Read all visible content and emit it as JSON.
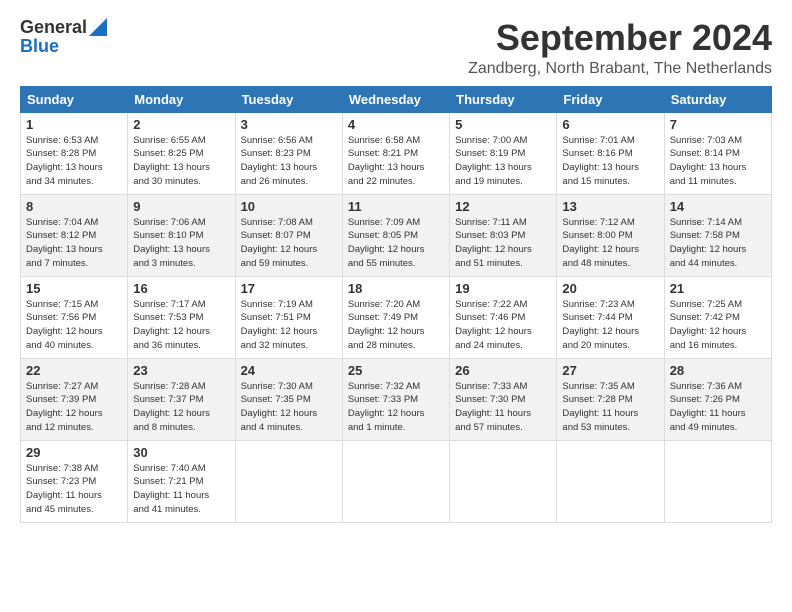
{
  "logo": {
    "general": "General",
    "blue": "Blue"
  },
  "header": {
    "month": "September 2024",
    "location": "Zandberg, North Brabant, The Netherlands"
  },
  "days_of_week": [
    "Sunday",
    "Monday",
    "Tuesday",
    "Wednesday",
    "Thursday",
    "Friday",
    "Saturday"
  ],
  "weeks": [
    [
      {
        "day": "1",
        "info": "Sunrise: 6:53 AM\nSunset: 8:28 PM\nDaylight: 13 hours\nand 34 minutes."
      },
      {
        "day": "2",
        "info": "Sunrise: 6:55 AM\nSunset: 8:25 PM\nDaylight: 13 hours\nand 30 minutes."
      },
      {
        "day": "3",
        "info": "Sunrise: 6:56 AM\nSunset: 8:23 PM\nDaylight: 13 hours\nand 26 minutes."
      },
      {
        "day": "4",
        "info": "Sunrise: 6:58 AM\nSunset: 8:21 PM\nDaylight: 13 hours\nand 22 minutes."
      },
      {
        "day": "5",
        "info": "Sunrise: 7:00 AM\nSunset: 8:19 PM\nDaylight: 13 hours\nand 19 minutes."
      },
      {
        "day": "6",
        "info": "Sunrise: 7:01 AM\nSunset: 8:16 PM\nDaylight: 13 hours\nand 15 minutes."
      },
      {
        "day": "7",
        "info": "Sunrise: 7:03 AM\nSunset: 8:14 PM\nDaylight: 13 hours\nand 11 minutes."
      }
    ],
    [
      {
        "day": "8",
        "info": "Sunrise: 7:04 AM\nSunset: 8:12 PM\nDaylight: 13 hours\nand 7 minutes."
      },
      {
        "day": "9",
        "info": "Sunrise: 7:06 AM\nSunset: 8:10 PM\nDaylight: 13 hours\nand 3 minutes."
      },
      {
        "day": "10",
        "info": "Sunrise: 7:08 AM\nSunset: 8:07 PM\nDaylight: 12 hours\nand 59 minutes."
      },
      {
        "day": "11",
        "info": "Sunrise: 7:09 AM\nSunset: 8:05 PM\nDaylight: 12 hours\nand 55 minutes."
      },
      {
        "day": "12",
        "info": "Sunrise: 7:11 AM\nSunset: 8:03 PM\nDaylight: 12 hours\nand 51 minutes."
      },
      {
        "day": "13",
        "info": "Sunrise: 7:12 AM\nSunset: 8:00 PM\nDaylight: 12 hours\nand 48 minutes."
      },
      {
        "day": "14",
        "info": "Sunrise: 7:14 AM\nSunset: 7:58 PM\nDaylight: 12 hours\nand 44 minutes."
      }
    ],
    [
      {
        "day": "15",
        "info": "Sunrise: 7:15 AM\nSunset: 7:56 PM\nDaylight: 12 hours\nand 40 minutes."
      },
      {
        "day": "16",
        "info": "Sunrise: 7:17 AM\nSunset: 7:53 PM\nDaylight: 12 hours\nand 36 minutes."
      },
      {
        "day": "17",
        "info": "Sunrise: 7:19 AM\nSunset: 7:51 PM\nDaylight: 12 hours\nand 32 minutes."
      },
      {
        "day": "18",
        "info": "Sunrise: 7:20 AM\nSunset: 7:49 PM\nDaylight: 12 hours\nand 28 minutes."
      },
      {
        "day": "19",
        "info": "Sunrise: 7:22 AM\nSunset: 7:46 PM\nDaylight: 12 hours\nand 24 minutes."
      },
      {
        "day": "20",
        "info": "Sunrise: 7:23 AM\nSunset: 7:44 PM\nDaylight: 12 hours\nand 20 minutes."
      },
      {
        "day": "21",
        "info": "Sunrise: 7:25 AM\nSunset: 7:42 PM\nDaylight: 12 hours\nand 16 minutes."
      }
    ],
    [
      {
        "day": "22",
        "info": "Sunrise: 7:27 AM\nSunset: 7:39 PM\nDaylight: 12 hours\nand 12 minutes."
      },
      {
        "day": "23",
        "info": "Sunrise: 7:28 AM\nSunset: 7:37 PM\nDaylight: 12 hours\nand 8 minutes."
      },
      {
        "day": "24",
        "info": "Sunrise: 7:30 AM\nSunset: 7:35 PM\nDaylight: 12 hours\nand 4 minutes."
      },
      {
        "day": "25",
        "info": "Sunrise: 7:32 AM\nSunset: 7:33 PM\nDaylight: 12 hours\nand 1 minute."
      },
      {
        "day": "26",
        "info": "Sunrise: 7:33 AM\nSunset: 7:30 PM\nDaylight: 11 hours\nand 57 minutes."
      },
      {
        "day": "27",
        "info": "Sunrise: 7:35 AM\nSunset: 7:28 PM\nDaylight: 11 hours\nand 53 minutes."
      },
      {
        "day": "28",
        "info": "Sunrise: 7:36 AM\nSunset: 7:26 PM\nDaylight: 11 hours\nand 49 minutes."
      }
    ],
    [
      {
        "day": "29",
        "info": "Sunrise: 7:38 AM\nSunset: 7:23 PM\nDaylight: 11 hours\nand 45 minutes."
      },
      {
        "day": "30",
        "info": "Sunrise: 7:40 AM\nSunset: 7:21 PM\nDaylight: 11 hours\nand 41 minutes."
      },
      null,
      null,
      null,
      null,
      null
    ]
  ]
}
